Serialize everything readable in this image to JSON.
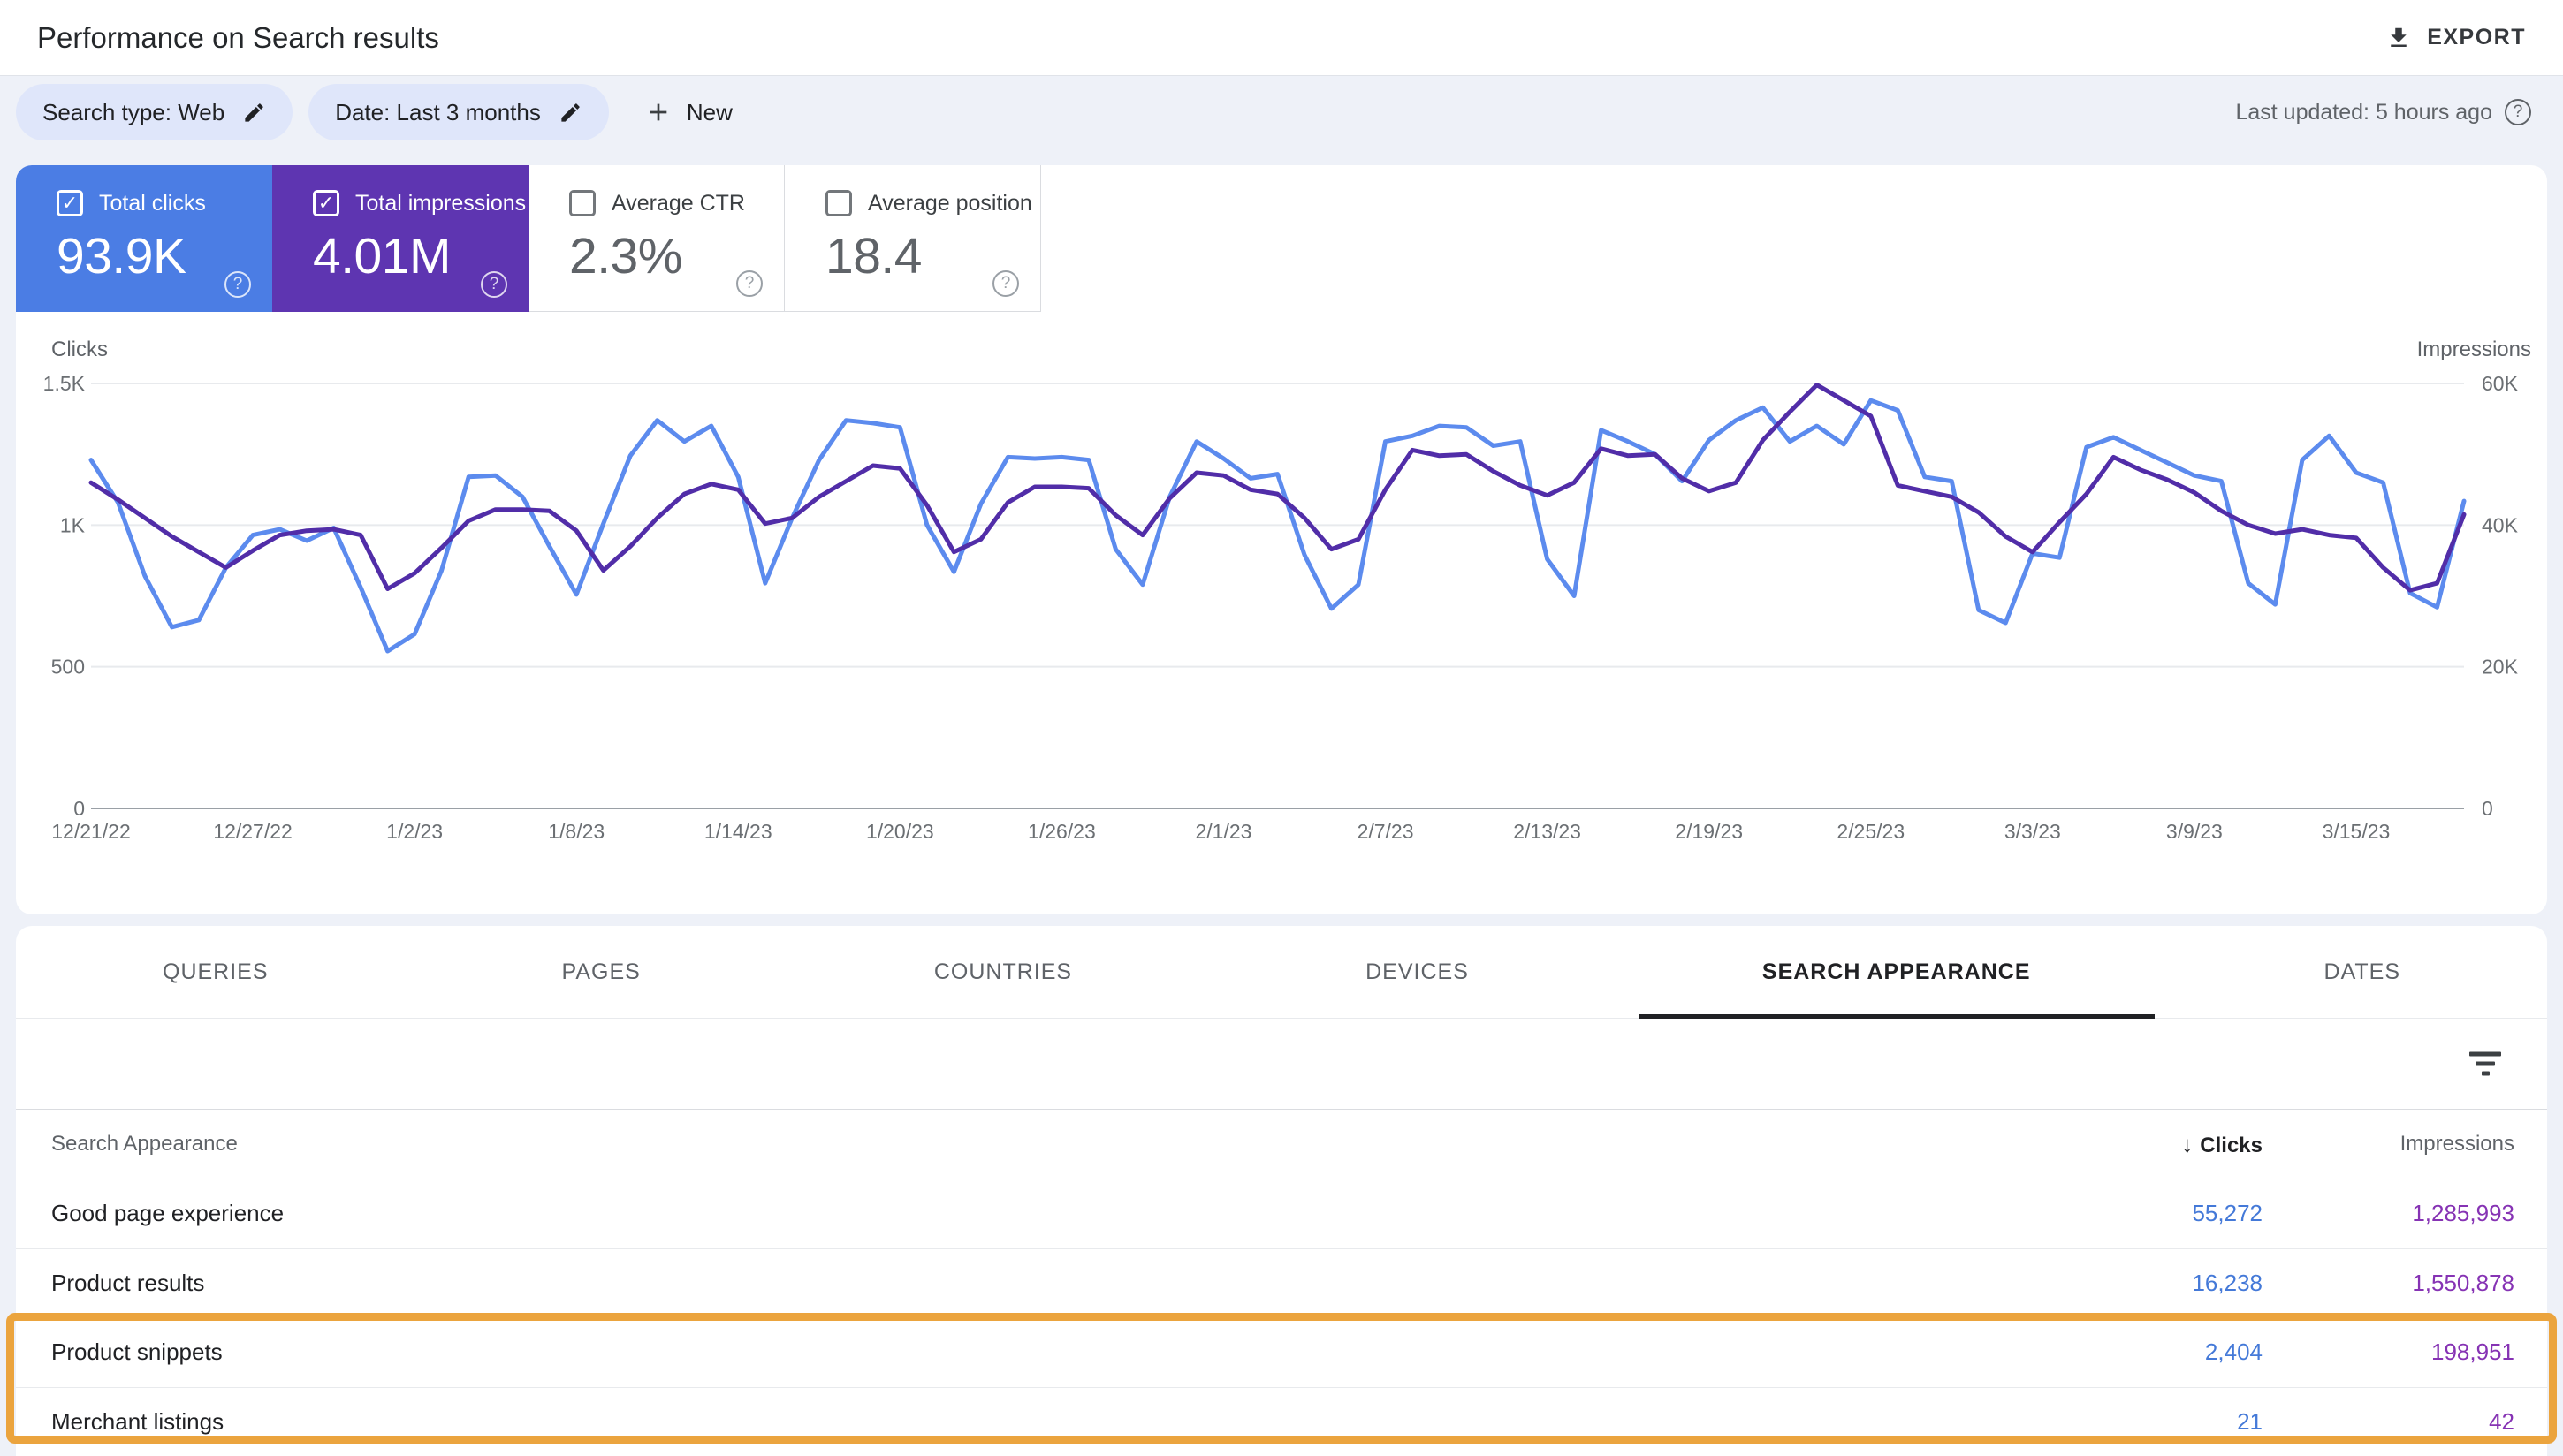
{
  "header": {
    "title": "Performance on Search results",
    "export_label": "EXPORT"
  },
  "filters": {
    "chips": [
      {
        "label": "Search type: Web"
      },
      {
        "label": "Date: Last 3 months"
      }
    ],
    "new_label": "New",
    "last_updated": "Last updated: 5 hours ago"
  },
  "metric_cards": [
    {
      "label": "Total clicks",
      "value": "93.9K",
      "selected": true,
      "color": "#4b7de4"
    },
    {
      "label": "Total impressions",
      "value": "4.01M",
      "selected": true,
      "color": "#5e35b1"
    },
    {
      "label": "Average CTR",
      "value": "2.3%",
      "selected": false,
      "color": "#ffffff"
    },
    {
      "label": "Average position",
      "value": "18.4",
      "selected": false,
      "color": "#ffffff"
    }
  ],
  "chart_data": {
    "type": "line",
    "title": "Clicks and impressions over last 3 months (daily)",
    "legend": "none",
    "grid": true,
    "left_axis": {
      "label": "Clicks",
      "ticks": [
        "1.5K",
        "1K",
        "500",
        "0"
      ],
      "min": 0,
      "max": 1500
    },
    "right_axis": {
      "label": "Impressions",
      "ticks": [
        "60K",
        "40K",
        "20K",
        "0"
      ],
      "min": 0,
      "max": 60000
    },
    "x_tick_labels": [
      "12/21/22",
      "12/27/22",
      "1/2/23",
      "1/8/23",
      "1/14/23",
      "1/20/23",
      "1/26/23",
      "2/1/23",
      "2/7/23",
      "2/13/23",
      "2/19/23",
      "2/25/23",
      "3/3/23",
      "3/9/23",
      "3/15/23"
    ],
    "x_tick_step": 6,
    "x": [
      "12/21/22",
      "12/22/22",
      "12/23/22",
      "12/24/22",
      "12/25/22",
      "12/26/22",
      "12/27/22",
      "12/28/22",
      "12/29/22",
      "12/30/22",
      "12/31/22",
      "1/1/23",
      "1/2/23",
      "1/3/23",
      "1/4/23",
      "1/5/23",
      "1/6/23",
      "1/7/23",
      "1/8/23",
      "1/9/23",
      "1/10/23",
      "1/11/23",
      "1/12/23",
      "1/13/23",
      "1/14/23",
      "1/15/23",
      "1/16/23",
      "1/17/23",
      "1/18/23",
      "1/19/23",
      "1/20/23",
      "1/21/23",
      "1/22/23",
      "1/23/23",
      "1/24/23",
      "1/25/23",
      "1/26/23",
      "1/27/23",
      "1/28/23",
      "1/29/23",
      "1/30/23",
      "1/31/23",
      "2/1/23",
      "2/2/23",
      "2/3/23",
      "2/4/23",
      "2/5/23",
      "2/6/23",
      "2/7/23",
      "2/8/23",
      "2/9/23",
      "2/10/23",
      "2/11/23",
      "2/12/23",
      "2/13/23",
      "2/14/23",
      "2/15/23",
      "2/16/23",
      "2/17/23",
      "2/18/23",
      "2/19/23",
      "2/20/23",
      "2/21/23",
      "2/22/23",
      "2/23/23",
      "2/24/23",
      "2/25/23",
      "2/26/23",
      "2/27/23",
      "2/28/23",
      "3/1/23",
      "3/2/23",
      "3/3/23",
      "3/4/23",
      "3/5/23",
      "3/6/23",
      "3/7/23",
      "3/8/23",
      "3/9/23",
      "3/10/23",
      "3/11/23",
      "3/12/23",
      "3/13/23",
      "3/14/23",
      "3/15/23",
      "3/16/23",
      "3/17/23",
      "3/18/23",
      "3/19/23"
    ],
    "series": [
      {
        "name": "Clicks",
        "axis": "left",
        "color": "#5c8bee",
        "values": [
          1230,
          1080,
          820,
          640,
          665,
          850,
          965,
          985,
          945,
          990,
          780,
          555,
          615,
          840,
          1170,
          1175,
          1100,
          925,
          755,
          1005,
          1245,
          1370,
          1295,
          1350,
          1170,
          795,
          1025,
          1230,
          1370,
          1360,
          1345,
          1000,
          835,
          1075,
          1240,
          1235,
          1240,
          1230,
          915,
          790,
          1100,
          1295,
          1235,
          1165,
          1180,
          895,
          705,
          790,
          1295,
          1315,
          1350,
          1345,
          1280,
          1295,
          880,
          750,
          1335,
          1295,
          1250,
          1155,
          1300,
          1370,
          1415,
          1295,
          1350,
          1285,
          1440,
          1405,
          1170,
          1155,
          700,
          655,
          900,
          885,
          1275,
          1310,
          1265,
          1220,
          1175,
          1155,
          795,
          720,
          1230,
          1315,
          1185,
          1150,
          760,
          710,
          1085
        ]
      },
      {
        "name": "Impressions",
        "axis": "right",
        "color": "#512da8",
        "values": [
          46000,
          43600,
          41000,
          38400,
          36200,
          34000,
          36400,
          38600,
          39200,
          39400,
          38600,
          31000,
          33200,
          36800,
          40600,
          42200,
          42200,
          42000,
          39200,
          33600,
          37000,
          41000,
          44400,
          45800,
          45000,
          40200,
          41000,
          44000,
          46200,
          48400,
          48000,
          42800,
          36200,
          38000,
          43200,
          45400,
          45400,
          45200,
          41400,
          38600,
          43800,
          47400,
          47000,
          45000,
          44400,
          41000,
          36600,
          38000,
          45000,
          50600,
          49800,
          50000,
          47600,
          45600,
          44200,
          46000,
          50800,
          49800,
          50000,
          46600,
          44800,
          46000,
          52000,
          56000,
          59800,
          57600,
          55400,
          45600,
          44800,
          44000,
          41800,
          38400,
          36200,
          40400,
          44400,
          49600,
          47800,
          46400,
          44600,
          42000,
          40000,
          38800,
          39400,
          38600,
          38200,
          34000,
          30800,
          31800,
          41500
        ]
      }
    ]
  },
  "tabs": [
    {
      "label": "QUERIES",
      "active": false
    },
    {
      "label": "PAGES",
      "active": false
    },
    {
      "label": "COUNTRIES",
      "active": false
    },
    {
      "label": "DEVICES",
      "active": false
    },
    {
      "label": "SEARCH APPEARANCE",
      "active": true
    },
    {
      "label": "DATES",
      "active": false
    }
  ],
  "table": {
    "columns": {
      "dimension": "Search Appearance",
      "clicks": "Clicks",
      "impressions": "Impressions"
    },
    "sort": {
      "column": "clicks",
      "direction": "desc"
    },
    "clicks_color": "#4479d8",
    "impressions_color": "#8633b4",
    "highlight_color": "#eba43e",
    "rows": [
      {
        "name": "Good page experience",
        "clicks": "55,272",
        "impressions": "1,285,993",
        "highlighted": false
      },
      {
        "name": "Product results",
        "clicks": "16,238",
        "impressions": "1,550,878",
        "highlighted": false
      },
      {
        "name": "Product snippets",
        "clicks": "2,404",
        "impressions": "198,951",
        "highlighted": true
      },
      {
        "name": "Merchant listings",
        "clicks": "21",
        "impressions": "42",
        "highlighted": true
      }
    ]
  }
}
